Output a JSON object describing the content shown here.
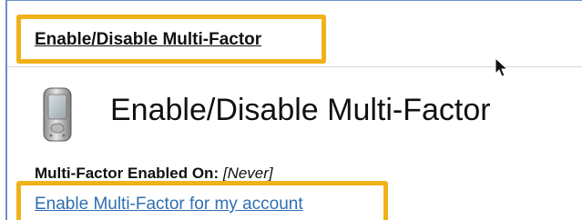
{
  "header": {
    "title": "Enable/Disable Multi-Factor"
  },
  "main": {
    "page_title": "Enable/Disable Multi-Factor",
    "status_label": "Multi-Factor Enabled On:",
    "status_value": "[Never]",
    "enable_link": "Enable Multi-Factor for my account"
  },
  "icons": {
    "device": "mobile-phone-icon",
    "cursor": "mouse-cursor-icon"
  },
  "colors": {
    "highlight": "#f0b21a",
    "link": "#2f6fb3",
    "border": "#6b8fc7"
  }
}
